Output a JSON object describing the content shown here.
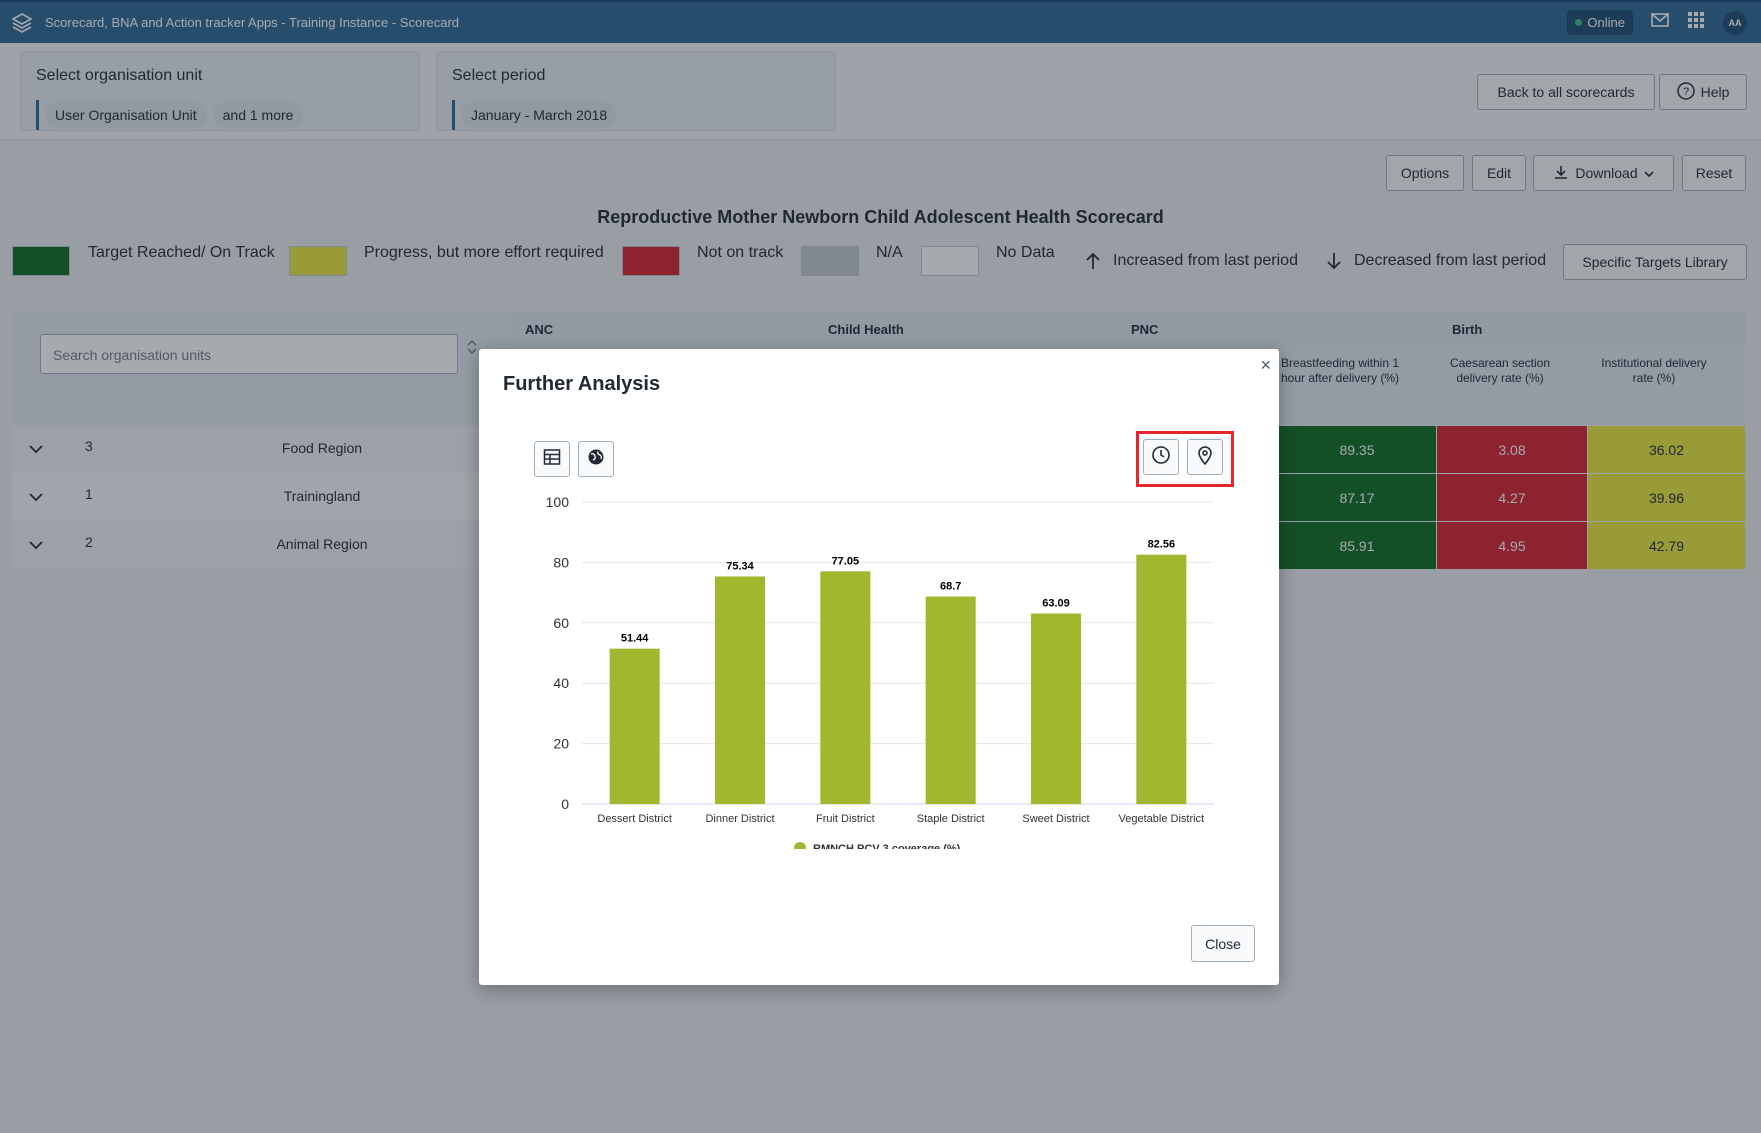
{
  "header": {
    "title": "Scorecard, BNA and Action tracker Apps - Training Instance - Scorecard",
    "status": "Online",
    "avatar": "AA"
  },
  "org_selector": {
    "title": "Select organisation unit",
    "chips": [
      "User Organisation Unit",
      "and 1 more"
    ]
  },
  "period_selector": {
    "title": "Select period",
    "value": "January - March 2018"
  },
  "top_buttons": {
    "back": "Back to all scorecards",
    "help": "Help"
  },
  "toolbar": {
    "options": "Options",
    "edit": "Edit",
    "download": "Download",
    "reset": "Reset"
  },
  "page_title": "Reproductive Mother Newborn Child Adolescent Health Scorecard",
  "legend": {
    "items": [
      {
        "label": "Target Reached/ On Track",
        "color": "#0d6b1e"
      },
      {
        "label": "Progress, but more effort required",
        "color": "#e8e83a"
      },
      {
        "label": "Not on track",
        "color": "#d6202a"
      },
      {
        "label": "N/A",
        "color": "#c4c9cf"
      },
      {
        "label": "No Data",
        "color": "#ffffff"
      }
    ],
    "increased": "Increased from last period",
    "decreased": "Decreased from last period",
    "specific_targets": "Specific Targets Library"
  },
  "table": {
    "search_placeholder": "Search organisation units",
    "groups": [
      "ANC",
      "Child Health",
      "PNC",
      "Birth"
    ],
    "columns": [
      "Breastfeeding within 1 hour after delivery (%)",
      "Caesarean section delivery rate (%)",
      "Institutional delivery rate (%)"
    ],
    "rows": [
      {
        "rank": "3",
        "name": "Food Region",
        "values": [
          "89.35",
          "3.08",
          "36.02"
        ]
      },
      {
        "rank": "1",
        "name": "Trainingland",
        "values": [
          "87.17",
          "4.27",
          "39.96"
        ]
      },
      {
        "rank": "2",
        "name": "Animal Region",
        "values": [
          "85.91",
          "4.95",
          "42.79"
        ]
      }
    ],
    "cell_colors": [
      "#0d6b1e",
      "#d6202a",
      "#e8e83a"
    ]
  },
  "modal": {
    "title": "Further Analysis",
    "close_label": "Close",
    "close_x": "×"
  },
  "chart_data": {
    "type": "bar",
    "categories": [
      "Dessert District",
      "Dinner District",
      "Fruit District",
      "Staple District",
      "Sweet District",
      "Vegetable District"
    ],
    "series": [
      {
        "name": "RMNCH PCV 3 coverage (%)",
        "values": [
          51.44,
          75.34,
          77.05,
          68.7,
          63.09,
          82.56
        ],
        "color": "#a1b82e"
      }
    ],
    "ylim": [
      0,
      100
    ],
    "yticks": [
      0,
      20,
      40,
      60,
      80,
      100
    ],
    "data_labels": true,
    "grid": true,
    "legend_position": "bottom-center"
  }
}
